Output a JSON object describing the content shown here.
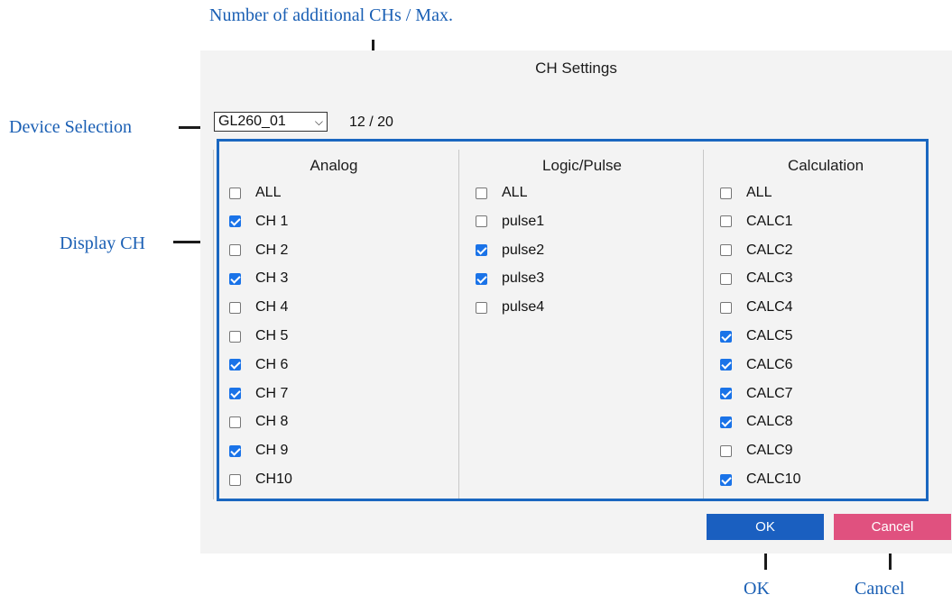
{
  "callouts": {
    "count_label": "Number of additional CHs / Max.",
    "device_label": "Device Selection",
    "display_label": "Display CH",
    "ok_label": "OK",
    "cancel_label": "Cancel"
  },
  "dialog": {
    "title": "CH Settings",
    "device": "GL260_01",
    "count": "12 / 20",
    "ok": "OK",
    "cancel": "Cancel"
  },
  "columns": [
    {
      "header": "Analog",
      "items": [
        {
          "label": "ALL",
          "checked": false
        },
        {
          "label": "CH 1",
          "checked": true
        },
        {
          "label": "CH 2",
          "checked": false
        },
        {
          "label": "CH 3",
          "checked": true
        },
        {
          "label": "CH 4",
          "checked": false
        },
        {
          "label": "CH 5",
          "checked": false
        },
        {
          "label": "CH 6",
          "checked": true
        },
        {
          "label": "CH 7",
          "checked": true
        },
        {
          "label": "CH 8",
          "checked": false
        },
        {
          "label": "CH 9",
          "checked": true
        },
        {
          "label": "CH10",
          "checked": false
        }
      ]
    },
    {
      "header": "Logic/Pulse",
      "items": [
        {
          "label": "ALL",
          "checked": false
        },
        {
          "label": "pulse1",
          "checked": false
        },
        {
          "label": "pulse2",
          "checked": true
        },
        {
          "label": "pulse3",
          "checked": true
        },
        {
          "label": "pulse4",
          "checked": false
        }
      ]
    },
    {
      "header": "Calculation",
      "items": [
        {
          "label": "ALL",
          "checked": false
        },
        {
          "label": "CALC1",
          "checked": false
        },
        {
          "label": "CALC2",
          "checked": false
        },
        {
          "label": "CALC3",
          "checked": false
        },
        {
          "label": "CALC4",
          "checked": false
        },
        {
          "label": "CALC5",
          "checked": true
        },
        {
          "label": "CALC6",
          "checked": true
        },
        {
          "label": "CALC7",
          "checked": true
        },
        {
          "label": "CALC8",
          "checked": true
        },
        {
          "label": "CALC9",
          "checked": false
        },
        {
          "label": "CALC10",
          "checked": true
        }
      ]
    }
  ],
  "colors": {
    "accent": "#1a67c0",
    "ok": "#1a5fc0",
    "cancel": "#e0517f",
    "check": "#1a73e8"
  }
}
